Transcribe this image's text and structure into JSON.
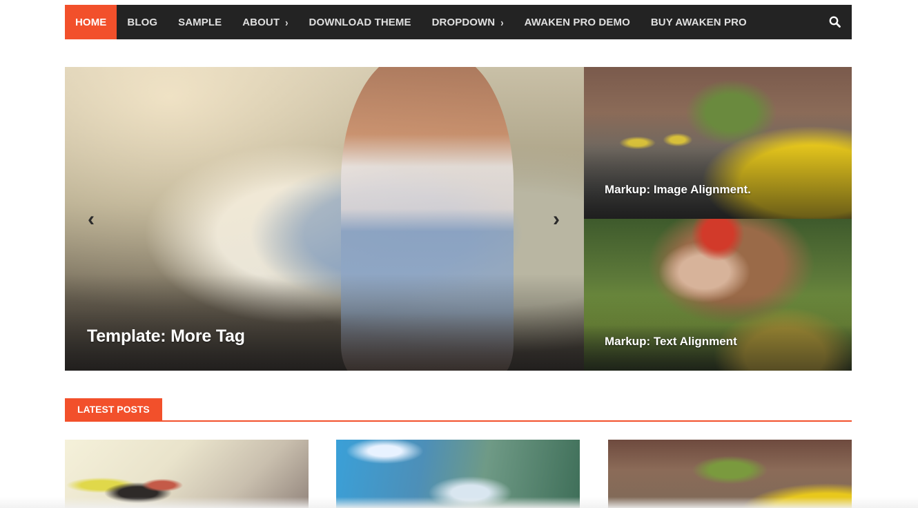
{
  "nav": {
    "items": [
      {
        "label": "HOME",
        "active": true,
        "has_submenu": false
      },
      {
        "label": "BLOG",
        "active": false,
        "has_submenu": false
      },
      {
        "label": "SAMPLE",
        "active": false,
        "has_submenu": false
      },
      {
        "label": "ABOUT",
        "active": false,
        "has_submenu": true
      },
      {
        "label": "DOWNLOAD THEME",
        "active": false,
        "has_submenu": false
      },
      {
        "label": "DROPDOWN",
        "active": false,
        "has_submenu": true
      },
      {
        "label": "AWAKEN PRO DEMO",
        "active": false,
        "has_submenu": false
      },
      {
        "label": "BUY AWAKEN PRO",
        "active": false,
        "has_submenu": false
      }
    ],
    "search_icon": "search-icon"
  },
  "slider": {
    "title": "Template: More Tag",
    "prev_icon": "chevron-left-icon",
    "next_icon": "chevron-right-icon"
  },
  "featured": [
    {
      "title": "Markup: Image Alignment."
    },
    {
      "title": "Markup: Text Alignment"
    }
  ],
  "latest": {
    "heading": "LATEST POSTS"
  },
  "colors": {
    "accent": "#f2502b",
    "nav_bg": "#232323"
  }
}
